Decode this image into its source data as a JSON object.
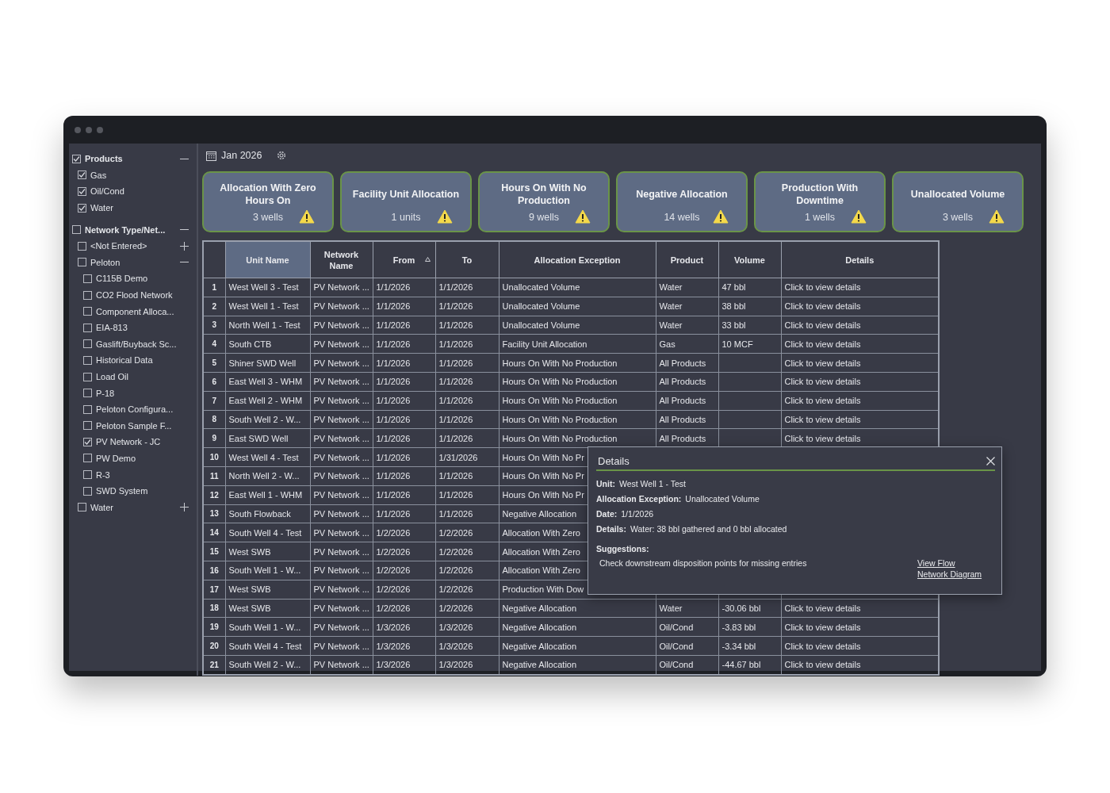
{
  "toolbar": {
    "period": "Jan 2026"
  },
  "sidebar": {
    "groups": [
      {
        "label": "Products",
        "checked": true,
        "expanded": true,
        "children": [
          {
            "label": "Gas",
            "checked": true
          },
          {
            "label": "Oil/Cond",
            "checked": true
          },
          {
            "label": "Water",
            "checked": true
          }
        ]
      },
      {
        "label": "Network Type/Net...",
        "checked": false,
        "expanded": true,
        "children": [
          {
            "label": "<Not Entered>",
            "checked": false,
            "expanded": false
          },
          {
            "label": "Peloton",
            "checked": false,
            "expanded": true,
            "children": [
              {
                "label": "C115B Demo",
                "checked": false
              },
              {
                "label": "CO2 Flood Network",
                "checked": false
              },
              {
                "label": "Component Alloca...",
                "checked": false
              },
              {
                "label": "EIA-813",
                "checked": false
              },
              {
                "label": "Gaslift/Buyback Sc...",
                "checked": false
              },
              {
                "label": "Historical Data",
                "checked": false
              },
              {
                "label": "Load Oil",
                "checked": false
              },
              {
                "label": "P-18",
                "checked": false
              },
              {
                "label": "Peloton Configura...",
                "checked": false
              },
              {
                "label": "Peloton Sample F...",
                "checked": false
              },
              {
                "label": "PV Network - JC",
                "checked": true
              },
              {
                "label": "PW Demo",
                "checked": false
              },
              {
                "label": "R-3",
                "checked": false
              },
              {
                "label": "SWD System",
                "checked": false
              }
            ]
          },
          {
            "label": "Water",
            "checked": false,
            "expanded": false
          }
        ]
      }
    ]
  },
  "cards": [
    {
      "title": "Allocation With Zero Hours On",
      "count": "3 wells"
    },
    {
      "title": "Facility Unit Allocation",
      "count": "1 units"
    },
    {
      "title": "Hours On With No Production",
      "count": "9 wells"
    },
    {
      "title": "Negative Allocation",
      "count": "14 wells"
    },
    {
      "title": "Production With Downtime",
      "count": "1 wells"
    },
    {
      "title": "Unallocated Volume",
      "count": "3 wells"
    }
  ],
  "table": {
    "columns": [
      {
        "label": "Unit Name",
        "highlighted": true,
        "sorted": false
      },
      {
        "label": "Network Name",
        "highlighted": false,
        "sorted": false
      },
      {
        "label": "From",
        "highlighted": false,
        "sorted": true
      },
      {
        "label": "To",
        "highlighted": false,
        "sorted": false
      },
      {
        "label": "Allocation Exception",
        "highlighted": false,
        "sorted": false
      },
      {
        "label": "Product",
        "highlighted": false,
        "sorted": false
      },
      {
        "label": "Volume",
        "highlighted": false,
        "sorted": false
      },
      {
        "label": "Details",
        "highlighted": false,
        "sorted": false
      }
    ],
    "rows": [
      {
        "num": "1",
        "cells": [
          "West Well 3 - Test",
          "PV Network ...",
          "1/1/2026",
          "1/1/2026",
          "Unallocated Volume",
          "Water",
          "47 bbl",
          "Click to view details"
        ]
      },
      {
        "num": "2",
        "cells": [
          "West Well 1 - Test",
          "PV Network ...",
          "1/1/2026",
          "1/1/2026",
          "Unallocated Volume",
          "Water",
          "38 bbl",
          "Click to view details"
        ]
      },
      {
        "num": "3",
        "cells": [
          "North Well 1 - Test",
          "PV Network ...",
          "1/1/2026",
          "1/1/2026",
          "Unallocated Volume",
          "Water",
          "33 bbl",
          "Click to view details"
        ]
      },
      {
        "num": "4",
        "cells": [
          "South CTB",
          "PV Network ...",
          "1/1/2026",
          "1/1/2026",
          "Facility Unit Allocation",
          "Gas",
          "10 MCF",
          "Click to view details"
        ]
      },
      {
        "num": "5",
        "cells": [
          "Shiner SWD Well",
          "PV Network ...",
          "1/1/2026",
          "1/1/2026",
          "Hours On With No Production",
          "All Products",
          null,
          "Click to view details"
        ]
      },
      {
        "num": "6",
        "cells": [
          "East Well 3 - WHM",
          "PV Network ...",
          "1/1/2026",
          "1/1/2026",
          "Hours On With No Production",
          "All Products",
          null,
          "Click to view details"
        ]
      },
      {
        "num": "7",
        "cells": [
          "East Well 2 - WHM",
          "PV Network ...",
          "1/1/2026",
          "1/1/2026",
          "Hours On With No Production",
          "All Products",
          null,
          "Click to view details"
        ]
      },
      {
        "num": "8",
        "cells": [
          "South Well 2 - W...",
          "PV Network ...",
          "1/1/2026",
          "1/1/2026",
          "Hours On With No Production",
          "All Products",
          null,
          "Click to view details"
        ]
      },
      {
        "num": "9",
        "cells": [
          "East SWD Well",
          "PV Network ...",
          "1/1/2026",
          "1/1/2026",
          "Hours On With No Production",
          "All Products",
          null,
          "Click to view details"
        ]
      },
      {
        "num": "10",
        "cells": [
          "West Well 4 - Test",
          "PV Network ...",
          "1/1/2026",
          "1/31/2026",
          "Hours On With No Pr"
        ]
      },
      {
        "num": "11",
        "cells": [
          "North Well 2 - W...",
          "PV Network ...",
          "1/1/2026",
          "1/1/2026",
          "Hours On With No Pr"
        ]
      },
      {
        "num": "12",
        "cells": [
          "East Well 1 - WHM",
          "PV Network ...",
          "1/1/2026",
          "1/1/2026",
          "Hours On With No Pr"
        ]
      },
      {
        "num": "13",
        "cells": [
          "South Flowback",
          "PV Network ...",
          "1/1/2026",
          "1/1/2026",
          "Negative Allocation"
        ]
      },
      {
        "num": "14",
        "cells": [
          "South Well 4 - Test",
          "PV Network ...",
          "1/2/2026",
          "1/2/2026",
          "Allocation With Zero"
        ]
      },
      {
        "num": "15",
        "cells": [
          "West SWB",
          "PV Network ...",
          "1/2/2026",
          "1/2/2026",
          "Allocation With Zero"
        ]
      },
      {
        "num": "16",
        "cells": [
          "South Well 1 - W...",
          "PV Network ...",
          "1/2/2026",
          "1/2/2026",
          "Allocation With Zero"
        ]
      },
      {
        "num": "17",
        "cells": [
          "West SWB",
          "PV Network ...",
          "1/2/2026",
          "1/2/2026",
          "Production With Dow"
        ]
      },
      {
        "num": "18",
        "cells": [
          "West SWB",
          "PV Network ...",
          "1/2/2026",
          "1/2/2026",
          "Negative Allocation",
          "Water",
          "-30.06 bbl",
          "Click to view details"
        ]
      },
      {
        "num": "19",
        "cells": [
          "South Well 1 - W...",
          "PV Network ...",
          "1/3/2026",
          "1/3/2026",
          "Negative Allocation",
          "Oil/Cond",
          "-3.83 bbl",
          "Click to view details"
        ]
      },
      {
        "num": "20",
        "cells": [
          "South Well 4 - Test",
          "PV Network ...",
          "1/3/2026",
          "1/3/2026",
          "Negative Allocation",
          "Oil/Cond",
          "-3.34 bbl",
          "Click to view details"
        ]
      },
      {
        "num": "21",
        "cells": [
          "South Well 2 - W...",
          "PV Network ...",
          "1/3/2026",
          "1/3/2026",
          "Negative Allocation",
          "Oil/Cond",
          "-44.67 bbl",
          "Click to view details"
        ]
      }
    ]
  },
  "details_popup": {
    "title": "Details",
    "fields": [
      {
        "label": "Unit:",
        "value": "West Well 1 - Test"
      },
      {
        "label": "Allocation Exception:",
        "value": "Unallocated Volume"
      },
      {
        "label": "Date:",
        "value": "1/1/2026"
      },
      {
        "label": "Details:",
        "value": "Water: 38 bbl gathered and 0 bbl allocated"
      }
    ],
    "suggestions_heading": "Suggestions:",
    "suggestion": "Check downstream disposition points for missing entries",
    "link": "View Flow Network Diagram"
  }
}
